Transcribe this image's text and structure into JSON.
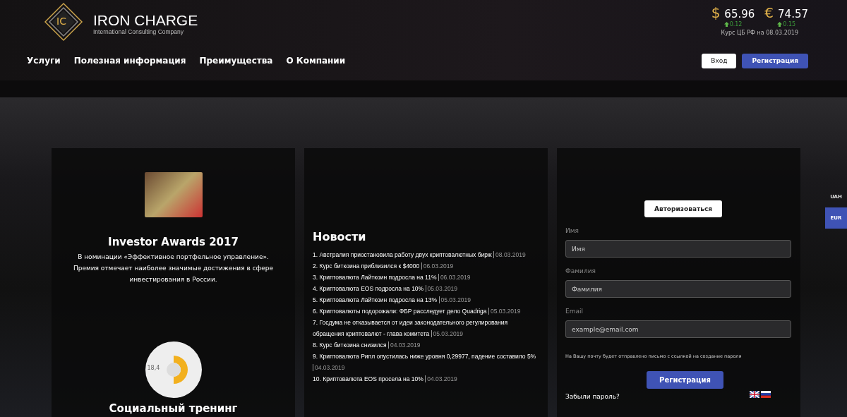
{
  "logo": {
    "name": "IRON CHARGE",
    "tagline": "International Consulting Company",
    "monogram": "IC"
  },
  "nav": [
    "Услуги",
    "Полезная информация",
    "Преимущества",
    "О Компании"
  ],
  "rates": [
    {
      "symbol": "$",
      "value": "65.96",
      "change": "0.12"
    },
    {
      "symbol": "€",
      "value": "74.57",
      "change": "0.15"
    }
  ],
  "rates_note": "Курс ЦБ РФ на 08.03.2019",
  "header_buttons": [
    {
      "label": "Вход",
      "kind": "secondary"
    },
    {
      "label": "Регистрация",
      "kind": "primary"
    }
  ],
  "award": {
    "title": "Investor Awards 2017",
    "text": "В номинации «Эффективное портфельное управление». Премия отмечает наиболее значимые достижения в сфере инвестирования в России."
  },
  "training": {
    "title": "Социальный тренинг",
    "chart_label": "18,4"
  },
  "news": {
    "title": "Новости",
    "items": [
      {
        "text": "1. Австралия приостановила работу двух криптовалютных бирж",
        "date": "08.03.2019"
      },
      {
        "text": "2. Курс биткоина приблизился к $4000",
        "date": "06.03.2019"
      },
      {
        "text": "3. Криптовалюта Лайткоин подросла на 11%",
        "date": "06.03.2019"
      },
      {
        "text": "4. Криптовалюта EOS подросла на 10%",
        "date": "05.03.2019"
      },
      {
        "text": "5. Криптовалюта Лайткоин подросла на 13%",
        "date": "05.03.2019"
      },
      {
        "text": "6. Криптовалюты подорожали: ФБР расследует дело Quadriga",
        "date": "05.03.2019"
      },
      {
        "text": "7. Госдума не отказывается от идеи законодательного регулирования обращения криптовалют - глава комитета",
        "date": "05.03.2019"
      },
      {
        "text": "8. Курс биткоина снизился",
        "date": "04.03.2019"
      },
      {
        "text": "9. Криптовалюта Рипл опустилась ниже уровня 0,29977, падение составило 5%",
        "date": "04.03.2019"
      },
      {
        "text": "10. Криптовалюта EOS просела на 10%",
        "date": "04.03.2019"
      }
    ]
  },
  "form": {
    "auth_button": "Авторизоваться",
    "fields": [
      {
        "label": "Имя",
        "placeholder": "Имя"
      },
      {
        "label": "Фамилия",
        "placeholder": "Фамилия"
      },
      {
        "label": "Email",
        "placeholder": "example@email.com"
      }
    ],
    "note": "На Вашу почту будет отправлено письмо с ссылкой на создание пароля",
    "submit": "Регистрация",
    "forgot": "Забыли пароль?"
  },
  "currency_tabs": [
    {
      "label": "UAH",
      "selected": false
    },
    {
      "label": "EUR",
      "selected": true
    }
  ]
}
